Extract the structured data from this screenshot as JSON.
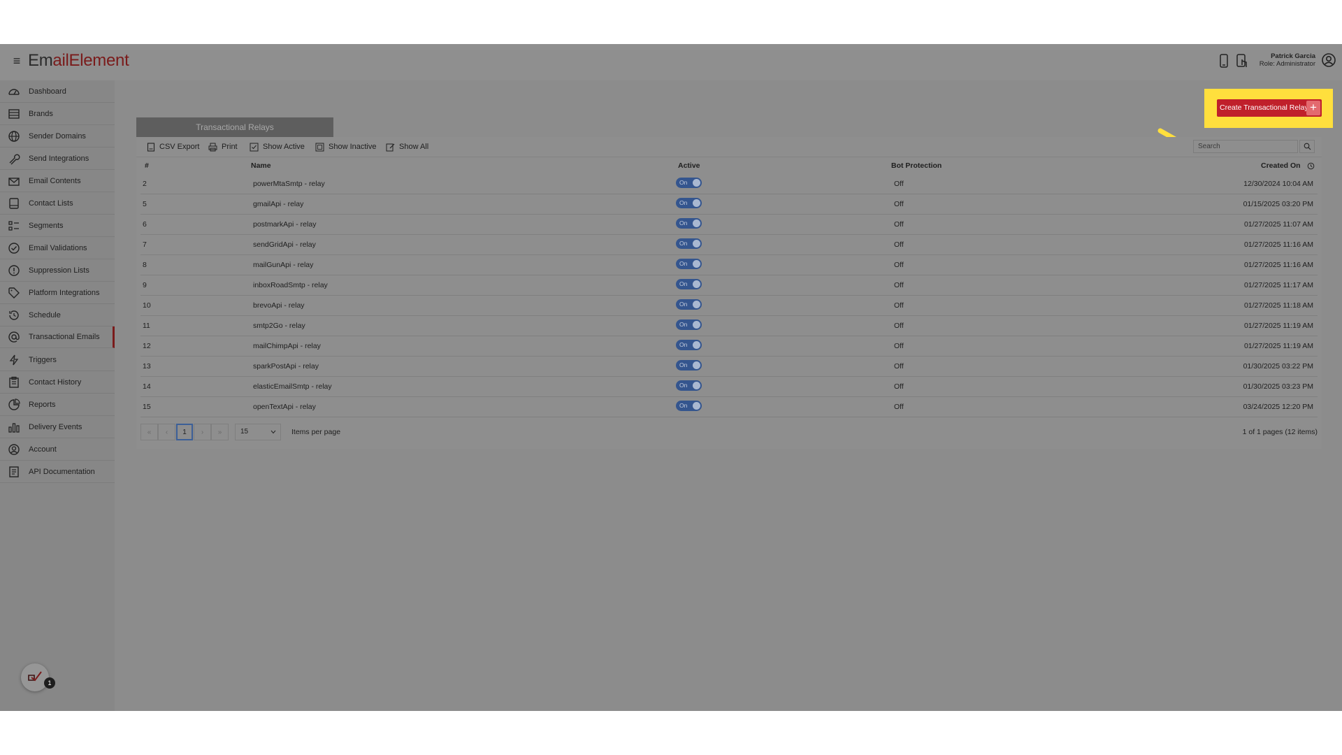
{
  "header": {
    "logo_prefix": "Em",
    "logo_suffix": "ailElement",
    "user_name": "Patrick Garcia",
    "user_role": "Role: Administrator"
  },
  "sidebar": {
    "items": [
      {
        "label": "Dashboard",
        "icon": "dashboard-icon"
      },
      {
        "label": "Brands",
        "icon": "brands-icon"
      },
      {
        "label": "Sender Domains",
        "icon": "globe-icon"
      },
      {
        "label": "Send Integrations",
        "icon": "wrench-icon"
      },
      {
        "label": "Email Contents",
        "icon": "envelope-icon"
      },
      {
        "label": "Contact Lists",
        "icon": "list-icon"
      },
      {
        "label": "Segments",
        "icon": "segments-icon"
      },
      {
        "label": "Email Validations",
        "icon": "check-circle-icon"
      },
      {
        "label": "Suppression Lists",
        "icon": "exclamation-circle-icon"
      },
      {
        "label": "Platform Integrations",
        "icon": "tag-icon"
      },
      {
        "label": "Schedule",
        "icon": "history-icon"
      },
      {
        "label": "Transactional Emails",
        "icon": "at-sign-icon"
      },
      {
        "label": "Triggers",
        "icon": "lightning-icon"
      },
      {
        "label": "Contact History",
        "icon": "clipboard-icon"
      },
      {
        "label": "Reports",
        "icon": "pie-chart-icon"
      },
      {
        "label": "Delivery Events",
        "icon": "bar-chart-icon"
      },
      {
        "label": "Account",
        "icon": "user-circle-icon"
      },
      {
        "label": "API Documentation",
        "icon": "document-icon"
      }
    ],
    "active_index": 11,
    "notification_count": "1"
  },
  "main": {
    "tab_title": "Transactional Relays",
    "create_button_label": "Create Transactional Relay",
    "create_button_plus": "+",
    "toolbar": {
      "csv_export": "CSV Export",
      "print": "Print",
      "show_active": "Show Active",
      "show_inactive": "Show Inactive",
      "show_all": "Show All",
      "search_placeholder": "Search"
    },
    "columns": {
      "num": "#",
      "name": "Name",
      "active": "Active",
      "bot_protection": "Bot Protection",
      "created_on": "Created On"
    },
    "rows": [
      {
        "num": "2",
        "name": "powerMtaSmtp - relay",
        "active": "On",
        "bot": "Off",
        "created": "12/30/2024 10:04 AM"
      },
      {
        "num": "5",
        "name": "gmailApi - relay",
        "active": "On",
        "bot": "Off",
        "created": "01/15/2025 03:20 PM"
      },
      {
        "num": "6",
        "name": "postmarkApi - relay",
        "active": "On",
        "bot": "Off",
        "created": "01/27/2025 11:07 AM"
      },
      {
        "num": "7",
        "name": "sendGridApi - relay",
        "active": "On",
        "bot": "Off",
        "created": "01/27/2025 11:16 AM"
      },
      {
        "num": "8",
        "name": "mailGunApi - relay",
        "active": "On",
        "bot": "Off",
        "created": "01/27/2025 11:16 AM"
      },
      {
        "num": "9",
        "name": "inboxRoadSmtp - relay",
        "active": "On",
        "bot": "Off",
        "created": "01/27/2025 11:17 AM"
      },
      {
        "num": "10",
        "name": "brevoApi - relay",
        "active": "On",
        "bot": "Off",
        "created": "01/27/2025 11:18 AM"
      },
      {
        "num": "11",
        "name": "smtp2Go - relay",
        "active": "On",
        "bot": "Off",
        "created": "01/27/2025 11:19 AM"
      },
      {
        "num": "12",
        "name": "mailChimpApi - relay",
        "active": "On",
        "bot": "Off",
        "created": "01/27/2025 11:19 AM"
      },
      {
        "num": "13",
        "name": "sparkPostApi - relay",
        "active": "On",
        "bot": "Off",
        "created": "01/30/2025 03:22 PM"
      },
      {
        "num": "14",
        "name": "elasticEmailSmtp - relay",
        "active": "On",
        "bot": "Off",
        "created": "01/30/2025 03:23 PM"
      },
      {
        "num": "15",
        "name": "openTextApi - relay",
        "active": "On",
        "bot": "Off",
        "created": "03/24/2025 12:20 PM"
      }
    ],
    "pager": {
      "first": "«",
      "prev": "‹",
      "current_page": "1",
      "next": "›",
      "last": "»",
      "page_size": "15",
      "items_per_page_label": "Items per page",
      "info": "1 of 1 pages (12 items)"
    }
  },
  "colors": {
    "brand_red": "#c0202b",
    "highlight_yellow": "#ffdf3d",
    "toggle_blue": "#34558e",
    "overlay_gray": "#8c8c8c"
  }
}
